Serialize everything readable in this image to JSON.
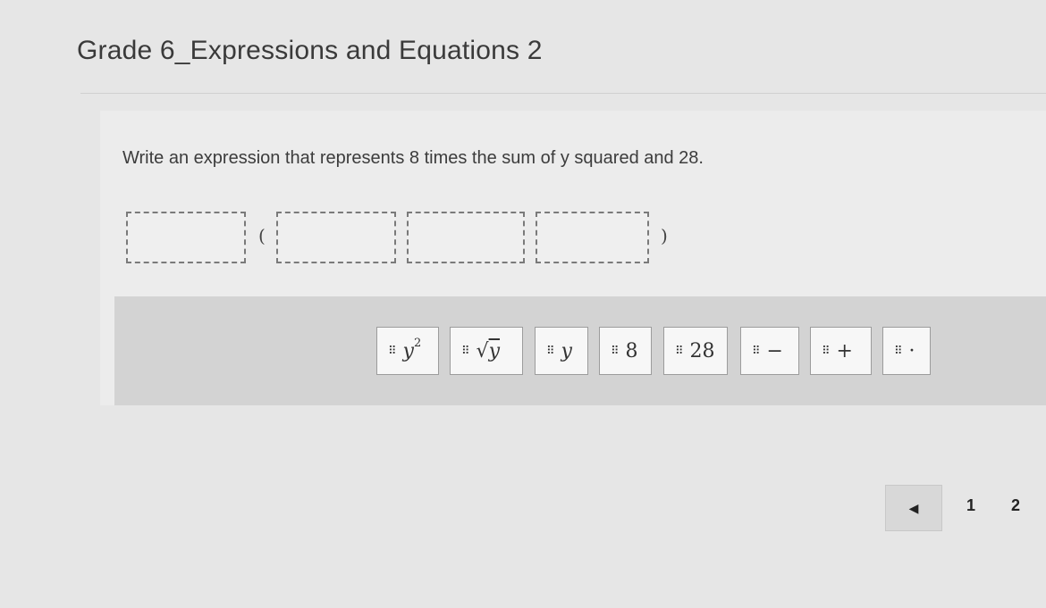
{
  "page": {
    "title": "Grade 6_Expressions and Equations 2"
  },
  "question": {
    "prompt": "Write an expression that represents 8 times the sum of y squared and 28.",
    "open_paren": "(",
    "close_paren": ")"
  },
  "tiles": [
    {
      "name": "y-squared",
      "base": "y",
      "sup": "2"
    },
    {
      "name": "sqrt-y",
      "radical": "√",
      "radicand": "y"
    },
    {
      "name": "y",
      "label": "y"
    },
    {
      "name": "eight",
      "label": "8"
    },
    {
      "name": "twenty-eight",
      "label": "28"
    },
    {
      "name": "minus",
      "label": "−"
    },
    {
      "name": "plus",
      "label": "+"
    },
    {
      "name": "times-dot",
      "label": "·"
    }
  ],
  "grip_glyph": "⠿",
  "pager": {
    "prev_icon": "◀",
    "pages": [
      "1",
      "2"
    ]
  },
  "colors": {
    "background": "#e6e6e6",
    "tray": "#d3d3d3",
    "tile": "#f7f7f7"
  }
}
